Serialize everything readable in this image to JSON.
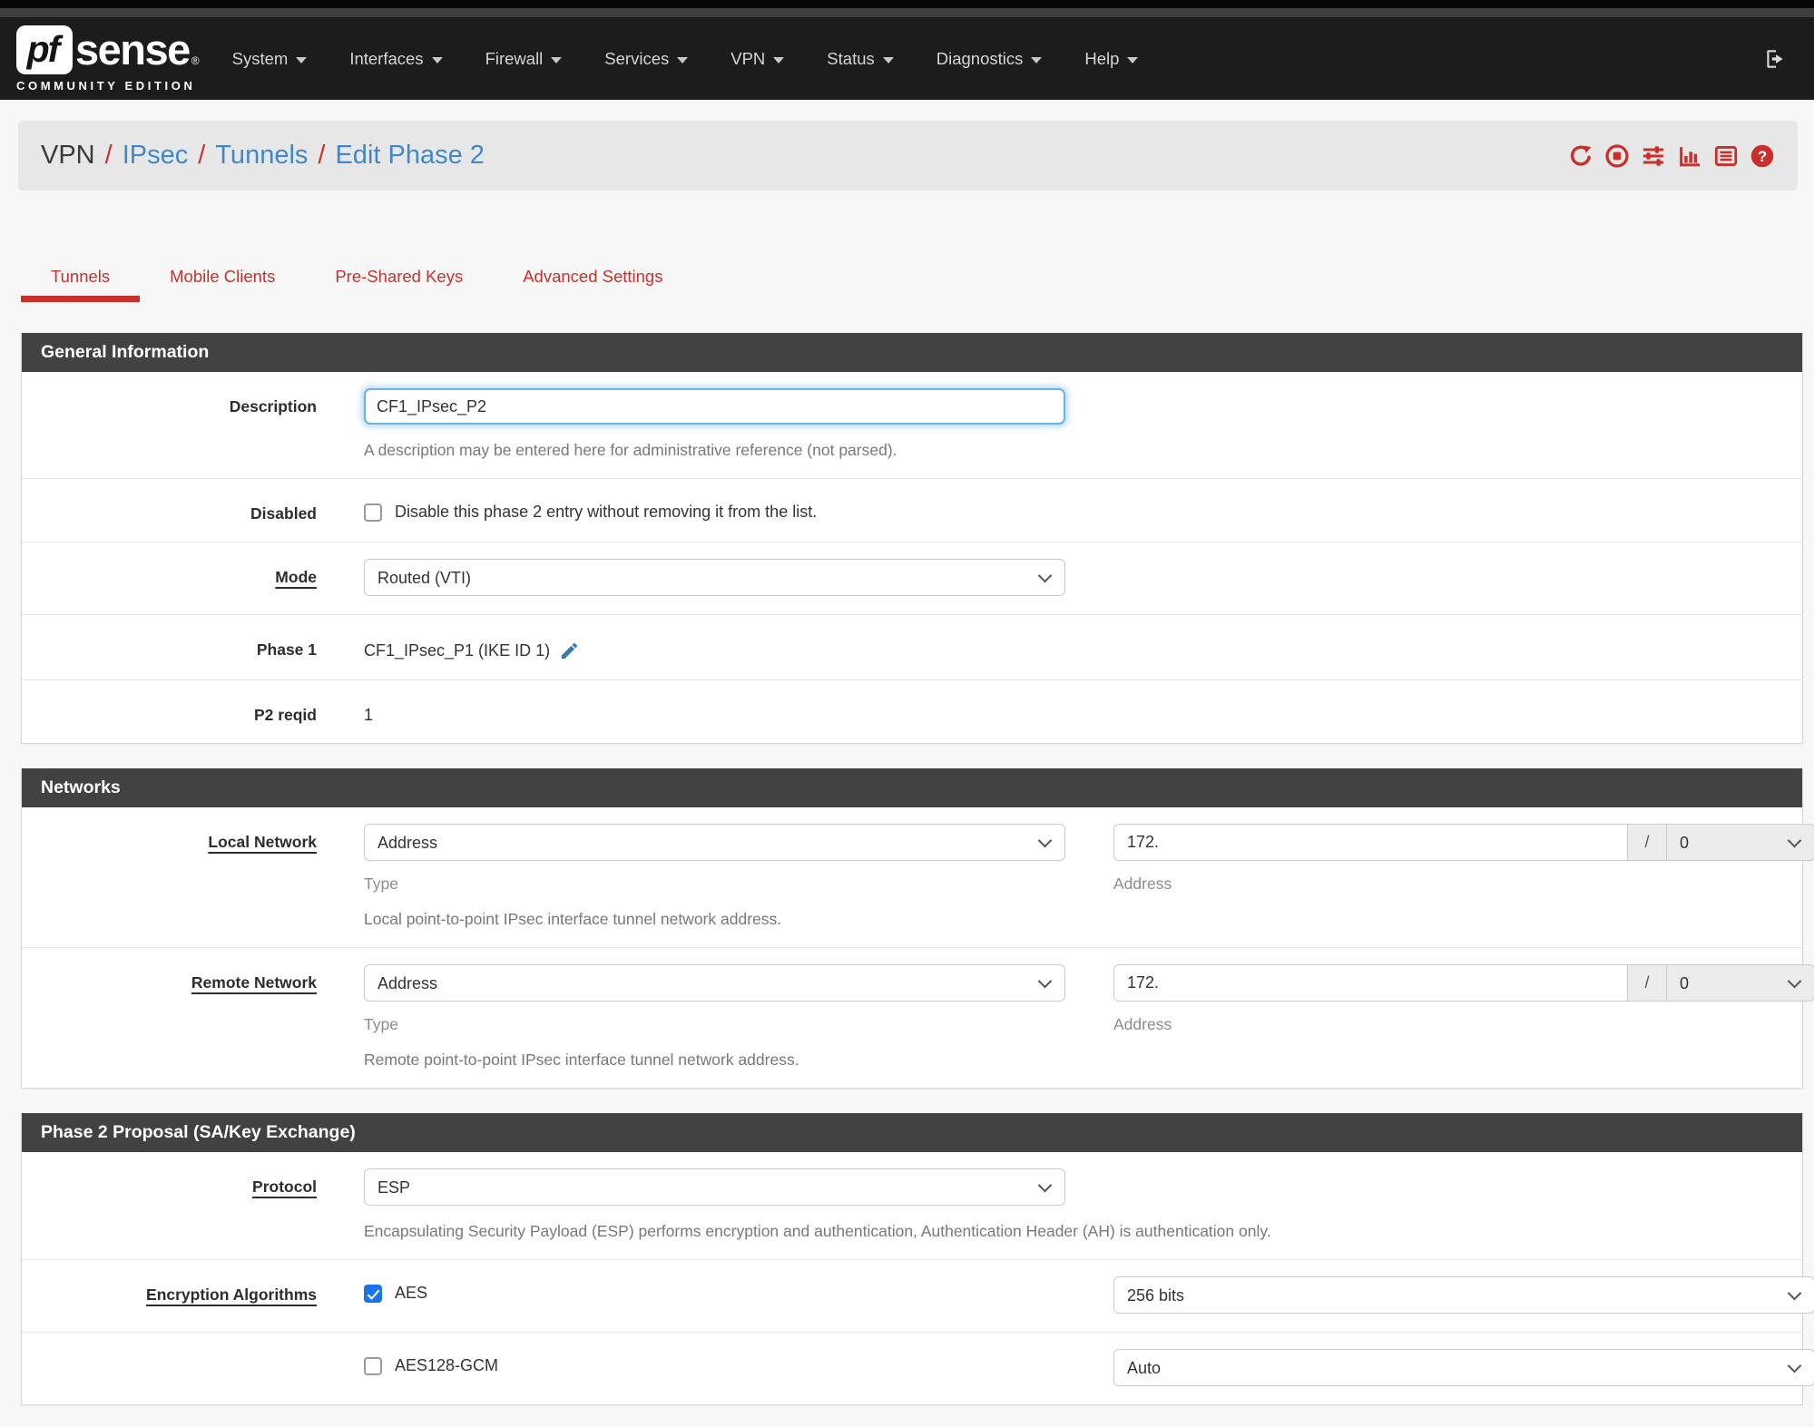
{
  "colors": {
    "accent_red": "#c9302c",
    "link_blue": "#4387c7",
    "panel_header_bg": "#424242",
    "navbar_bg": "#1c1c1c",
    "checkbox_checked_blue": "#1a73e8",
    "focused_input_blue": "#6fb0e8",
    "page_bg": "#f7f7f7",
    "breadcrumb_bg": "#e7e7e7"
  },
  "navbar": {
    "logo": {
      "mark": "pf",
      "name": "sense",
      "registered": "®",
      "edition": "COMMUNITY EDITION"
    },
    "items": [
      {
        "label": "System"
      },
      {
        "label": "Interfaces"
      },
      {
        "label": "Firewall"
      },
      {
        "label": "Services"
      },
      {
        "label": "VPN"
      },
      {
        "label": "Status"
      },
      {
        "label": "Diagnostics"
      },
      {
        "label": "Help"
      }
    ],
    "logout_icon": "sign-out-icon"
  },
  "breadcrumb": {
    "current": "VPN",
    "separator": "/",
    "links": [
      {
        "label": "IPsec"
      },
      {
        "label": "Tunnels"
      },
      {
        "label": "Edit Phase 2"
      }
    ]
  },
  "header_icons": [
    {
      "name": "refresh-icon"
    },
    {
      "name": "stop-icon"
    },
    {
      "name": "sliders-icon"
    },
    {
      "name": "bar-chart-icon"
    },
    {
      "name": "log-icon"
    },
    {
      "name": "help-icon"
    }
  ],
  "tabs": [
    {
      "label": "Tunnels",
      "active": true
    },
    {
      "label": "Mobile Clients",
      "active": false
    },
    {
      "label": "Pre-Shared Keys",
      "active": false
    },
    {
      "label": "Advanced Settings",
      "active": false
    }
  ],
  "general": {
    "title": "General Information",
    "description": {
      "label": "Description",
      "value": "CF1_IPsec_P2",
      "help": "A description may be entered here for administrative reference (not parsed)."
    },
    "disabled": {
      "label": "Disabled",
      "checkbox_label": "Disable this phase 2 entry without removing it from the list.",
      "checked": false
    },
    "mode": {
      "label": "Mode",
      "value": "Routed (VTI)"
    },
    "phase1": {
      "label": "Phase 1",
      "value": "CF1_IPsec_P1 (IKE ID 1)",
      "edit_icon": "pencil-icon"
    },
    "p2reqid": {
      "label": "P2 reqid",
      "value": "1"
    }
  },
  "networks": {
    "title": "Networks",
    "local": {
      "label": "Local Network",
      "type_value": "Address",
      "type_caption": "Type",
      "address_value": "172.",
      "mask_separator": "/",
      "mask_value": "0",
      "address_caption": "Address",
      "help": "Local point-to-point IPsec interface tunnel network address."
    },
    "remote": {
      "label": "Remote Network",
      "type_value": "Address",
      "type_caption": "Type",
      "address_value": "172.",
      "mask_separator": "/",
      "mask_value": "0",
      "address_caption": "Address",
      "help": "Remote point-to-point IPsec interface tunnel network address."
    }
  },
  "proposal": {
    "title": "Phase 2 Proposal (SA/Key Exchange)",
    "protocol": {
      "label": "Protocol",
      "value": "ESP",
      "help": "Encapsulating Security Payload (ESP) performs encryption and authentication, Authentication Header (AH) is authentication only."
    },
    "encryption": {
      "label": "Encryption Algorithms",
      "rows": [
        {
          "name": "AES",
          "checked": true,
          "bits": "256 bits"
        },
        {
          "name": "AES128-GCM",
          "checked": false,
          "bits": "Auto"
        }
      ]
    }
  }
}
